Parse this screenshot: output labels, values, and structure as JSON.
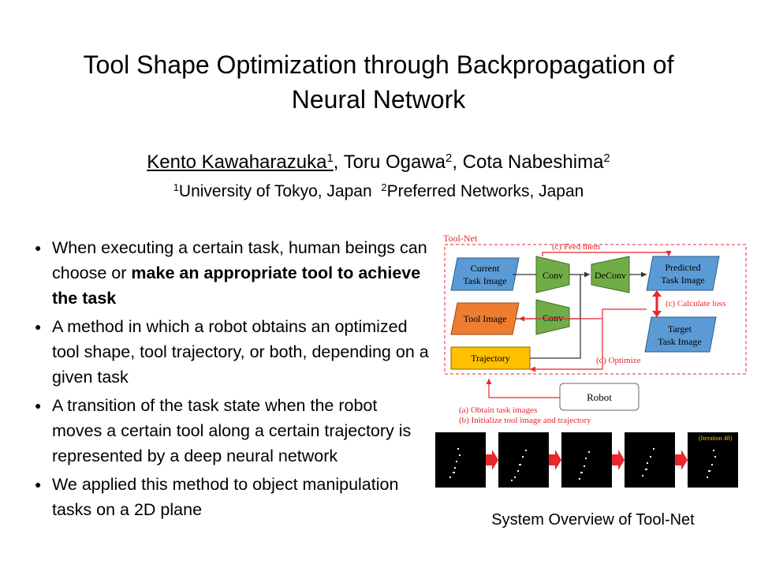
{
  "title": {
    "line1": "Tool Shape Optimization through Backpropagation of",
    "line2": "Neural Network"
  },
  "authors": [
    {
      "name": "Kento Kawaharazuka",
      "aff": "1",
      "sep": ", "
    },
    {
      "name": "Toru Ogawa",
      "aff": "2",
      "sep": ", "
    },
    {
      "name": "Cota Nabeshima",
      "aff": "2",
      "sep": ""
    }
  ],
  "affiliations": [
    {
      "num": "1",
      "text": "University of Tokyo, Japan"
    },
    {
      "num": "2",
      "text": "Preferred Networks, Japan"
    }
  ],
  "bullets": [
    {
      "pre": "When executing a certain task, human beings can choose or ",
      "bold": "make an appropriate tool to achieve the task",
      "post": ""
    },
    {
      "pre": "A method in which a robot obtains an optimized tool shape, tool trajectory, or both, depending on a given task",
      "bold": "",
      "post": ""
    },
    {
      "pre": "A transition of the task state when the robot moves a certain tool along a certain trajectory is represented by a deep neural network",
      "bold": "",
      "post": ""
    },
    {
      "pre": "We applied this method to object manipulation tasks on a 2D plane",
      "bold": "",
      "post": ""
    }
  ],
  "diagram": {
    "frame_label": "Tool-Net",
    "current_image": [
      "Current",
      "Task Image"
    ],
    "tool_image": "Tool Image",
    "trajectory": "Trajectory",
    "conv1": "Conv",
    "conv2": "Conv",
    "deconv": "DeConv",
    "predicted": [
      "Predicted",
      "Task Image"
    ],
    "target": [
      "Target",
      "Task Image"
    ],
    "feed": "(c) Feed them",
    "calc_loss": "(c) Calculate loss",
    "optimize": "(d) Optimize",
    "robot": "Robot",
    "obtain": "(a) Obtain task images",
    "init": "(b) Initialize tool image and trajectory",
    "colors": {
      "blue": "#5b9bd5",
      "orange": "#ed7d31",
      "green": "#70ad47",
      "yellow": "#ffc000",
      "red": "#e8262c"
    }
  },
  "strip": {
    "iteration_label": "(Iteration 48)"
  },
  "caption": "System Overview of Tool-Net"
}
